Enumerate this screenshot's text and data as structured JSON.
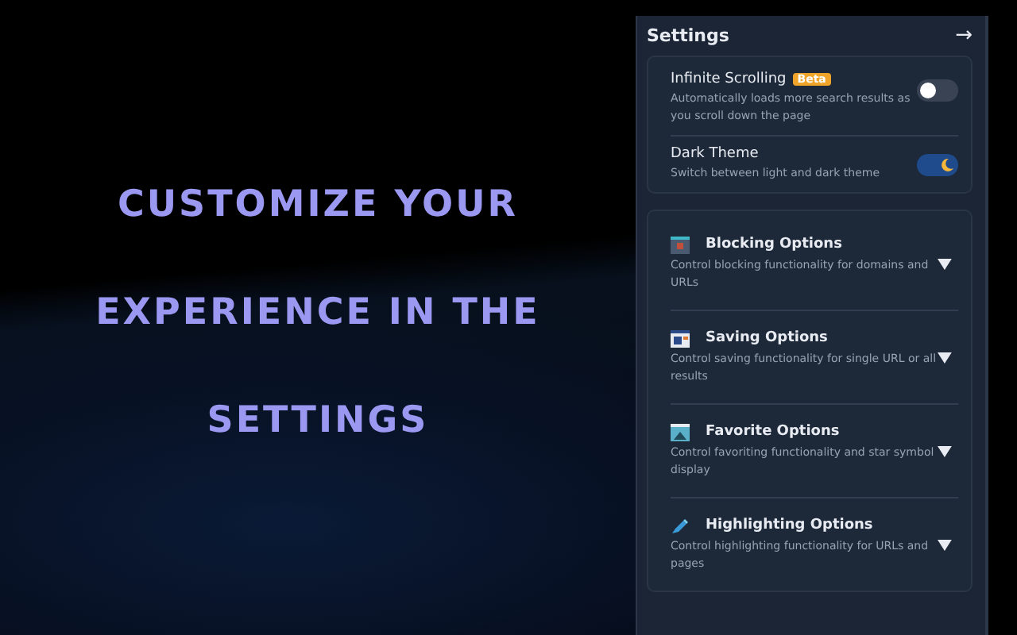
{
  "headline": "CUSTOMIZE YOUR EXPERIENCE IN THE SETTINGS",
  "panel": {
    "title": "Settings",
    "close": "→",
    "toggles": [
      {
        "label": "Infinite Scrolling",
        "badge": "Beta",
        "description": "Automatically loads more search results as you scroll down the page",
        "on": false
      },
      {
        "label": "Dark Theme",
        "description": "Switch between light and dark theme",
        "on": true
      }
    ],
    "sections": [
      {
        "title": "Blocking Options",
        "description": "Control blocking functionality for domains and URLs",
        "kind": "block",
        "expanded": false
      },
      {
        "title": "Saving Options",
        "description": "Control saving functionality for single URL or all results",
        "kind": "save",
        "expanded": false
      },
      {
        "title": "Favorite Options",
        "description": "Control favoriting functionality and star symbol display",
        "kind": "favorite",
        "expanded": false
      },
      {
        "title": "Highlighting Options",
        "description": "Control highlighting functionality for URLs and pages",
        "kind": "highlight",
        "expanded": false
      }
    ]
  }
}
